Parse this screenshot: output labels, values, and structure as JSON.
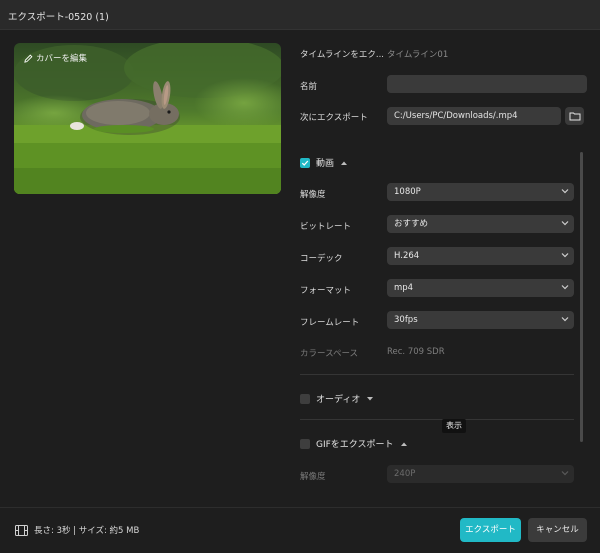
{
  "window": {
    "title": "エクスポート-0520 (1)"
  },
  "preview": {
    "cover_label": "カバーを編集"
  },
  "form": {
    "timeline_label": "タイムラインをエク...",
    "timeline_value": "タイムライン01",
    "name_label": "名前",
    "name_value": "",
    "export_to_label": "次にエクスポート",
    "export_path": "C:/Users/PC/Downloads/.mp4"
  },
  "video": {
    "section_label": "動画",
    "checked": true,
    "resolution_label": "解像度",
    "resolution_value": "1080P",
    "bitrate_label": "ビットレート",
    "bitrate_value": "おすすめ",
    "codec_label": "コーデック",
    "codec_value": "H.264",
    "format_label": "フォーマット",
    "format_value": "mp4",
    "framerate_label": "フレームレート",
    "framerate_value": "30fps",
    "colorspace_label": "カラースペース",
    "colorspace_value": "Rec. 709 SDR"
  },
  "audio": {
    "section_label": "オーディオ",
    "checked": false
  },
  "gif": {
    "section_label": "GIFをエクスポート",
    "checked": false,
    "resolution_label": "解像度",
    "resolution_value": "240P"
  },
  "tooltip": "表示",
  "footer": {
    "info": "長さ: 3秒 | サイズ: 約5 MB",
    "export_label": "エクスポート",
    "cancel_label": "キャンセル"
  },
  "colors": {
    "accent": "#21b9c6",
    "background": "#1e1e1e",
    "field": "#3a3a3a"
  },
  "icons": [
    "edit-icon",
    "folder-icon",
    "checkmark-icon",
    "caret-up-icon",
    "caret-down-icon",
    "chevron-down-icon",
    "film-icon"
  ]
}
